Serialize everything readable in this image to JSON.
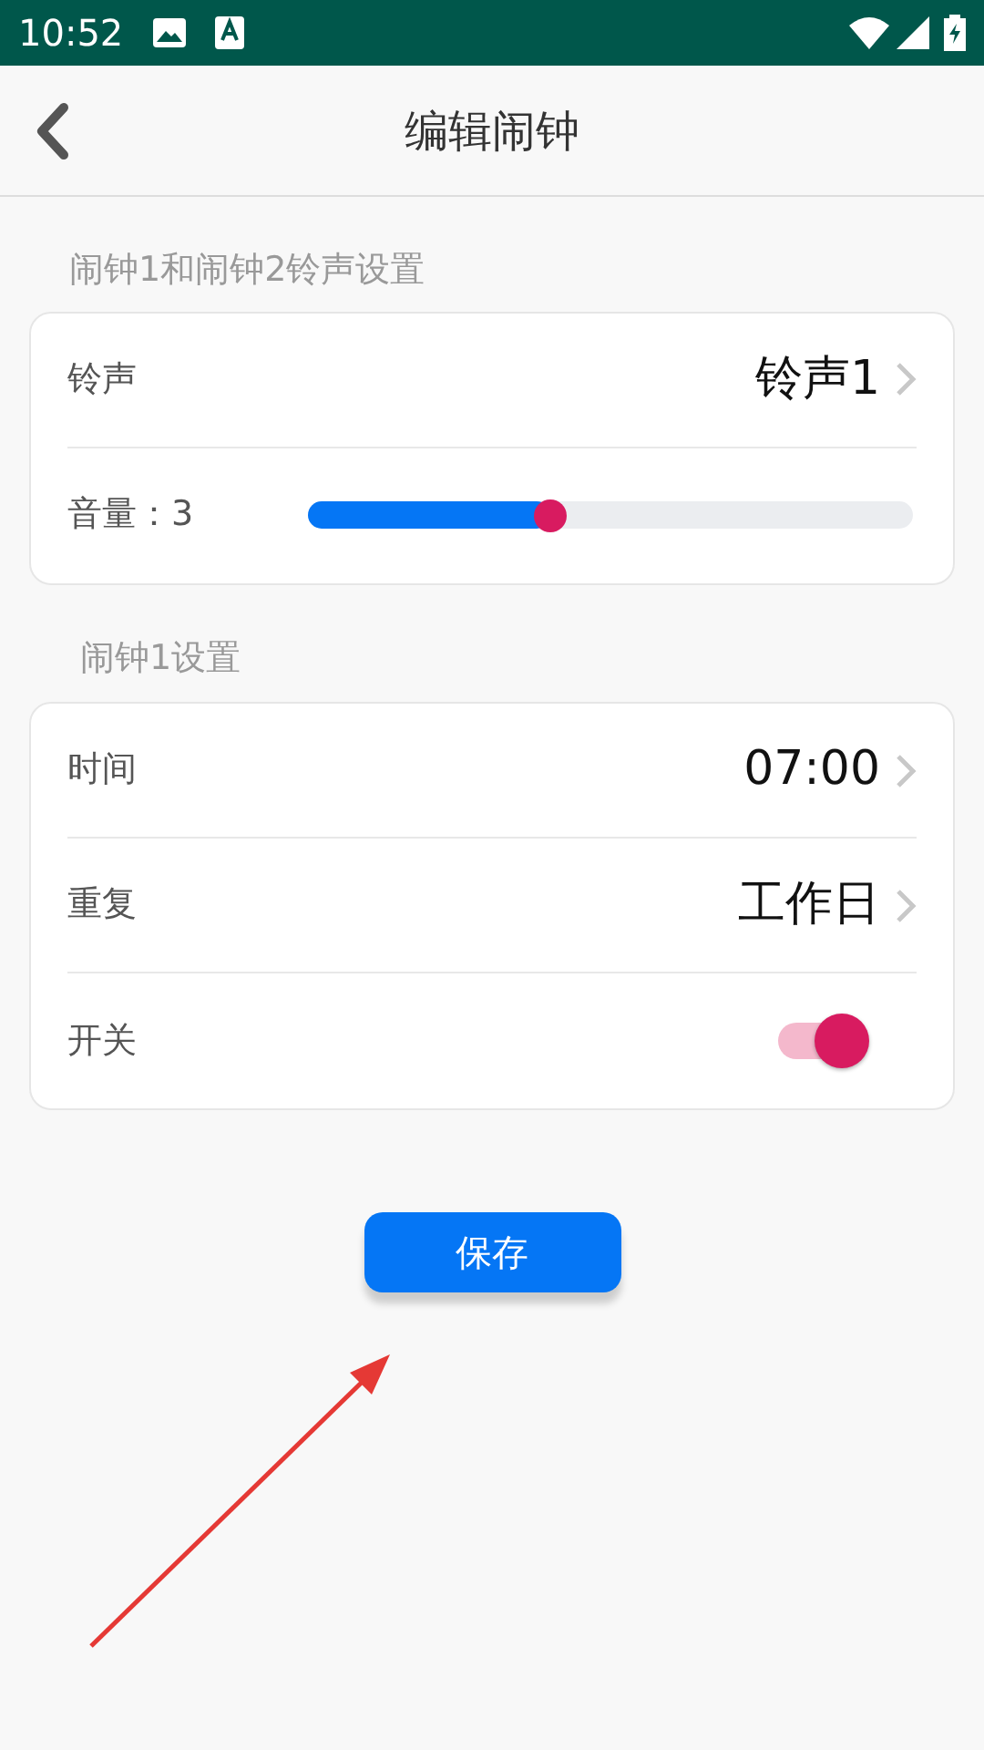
{
  "status_bar": {
    "time": "10:52"
  },
  "header": {
    "title": "编辑闹钟"
  },
  "sections": [
    {
      "label": "闹钟1和闹钟2铃声设置",
      "rows": [
        {
          "kind": "link",
          "label": "铃声",
          "value": "铃声1"
        },
        {
          "kind": "slider",
          "label": "音量：3",
          "level": 0.4
        }
      ]
    },
    {
      "label": "闹钟1设置",
      "rows": [
        {
          "kind": "link",
          "label": "时间",
          "value": "07:00"
        },
        {
          "kind": "link",
          "label": "重复",
          "value": "工作日"
        },
        {
          "kind": "switch",
          "label": "开关",
          "on": true
        }
      ]
    }
  ],
  "save_button": {
    "label": "保存"
  }
}
